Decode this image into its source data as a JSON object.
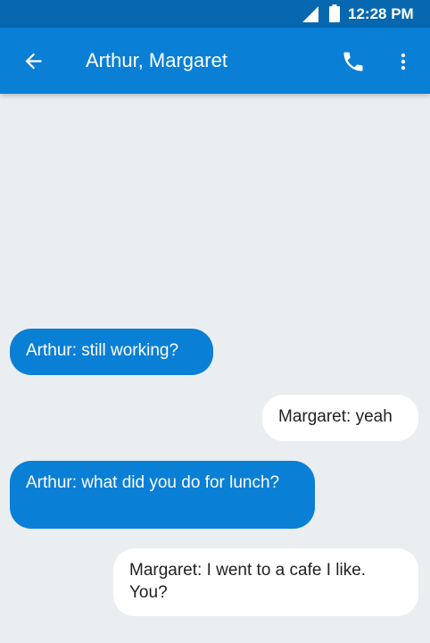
{
  "status_bar": {
    "time": "12:28 PM",
    "icons": [
      "signal-icon",
      "battery-icon"
    ]
  },
  "app_bar": {
    "title": "Arthur, Margaret",
    "icons": [
      "back-arrow-icon",
      "phone-icon",
      "more-vert-icon"
    ]
  },
  "messages": [
    {
      "direction": "incoming",
      "text": "Arthur: still working?"
    },
    {
      "direction": "outgoing",
      "text": "Margaret: yeah"
    },
    {
      "direction": "incoming",
      "text": "Arthur: what did you do for lunch?"
    },
    {
      "direction": "outgoing",
      "text": "Margaret: I went to a cafe I like. You?"
    }
  ],
  "colors": {
    "status_bar": "#0768b0",
    "app_bar": "#0a7fd6",
    "background": "#eaeef1",
    "incoming_bubble": "#0a7fd6",
    "outgoing_bubble": "#ffffff"
  }
}
